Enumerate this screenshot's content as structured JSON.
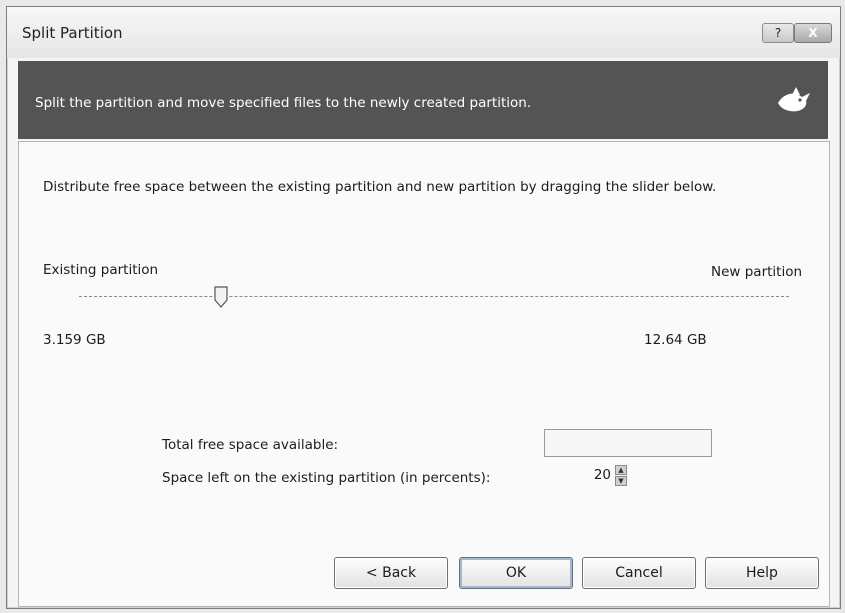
{
  "window": {
    "title": "Split Partition",
    "help_label": "?",
    "close_label": "X"
  },
  "banner": {
    "text": "Split the partition and move specified files to the newly created partition.",
    "icon": "wizard-bird-icon"
  },
  "main": {
    "instructions": "Distribute free space between the existing partition and new partition by dragging the slider below.",
    "existing_label": "Existing partition",
    "new_label": "New partition",
    "existing_size": "3.159 GB",
    "new_size": "12.64 GB",
    "slider_fraction": 0.2,
    "total_free_label": "Total free space available:",
    "total_free_value": "",
    "percent_label": "Space left on the existing partition (in percents):",
    "percent_value": "20"
  },
  "buttons": {
    "back": "< Back",
    "ok": "OK",
    "cancel": "Cancel",
    "help": "Help"
  }
}
